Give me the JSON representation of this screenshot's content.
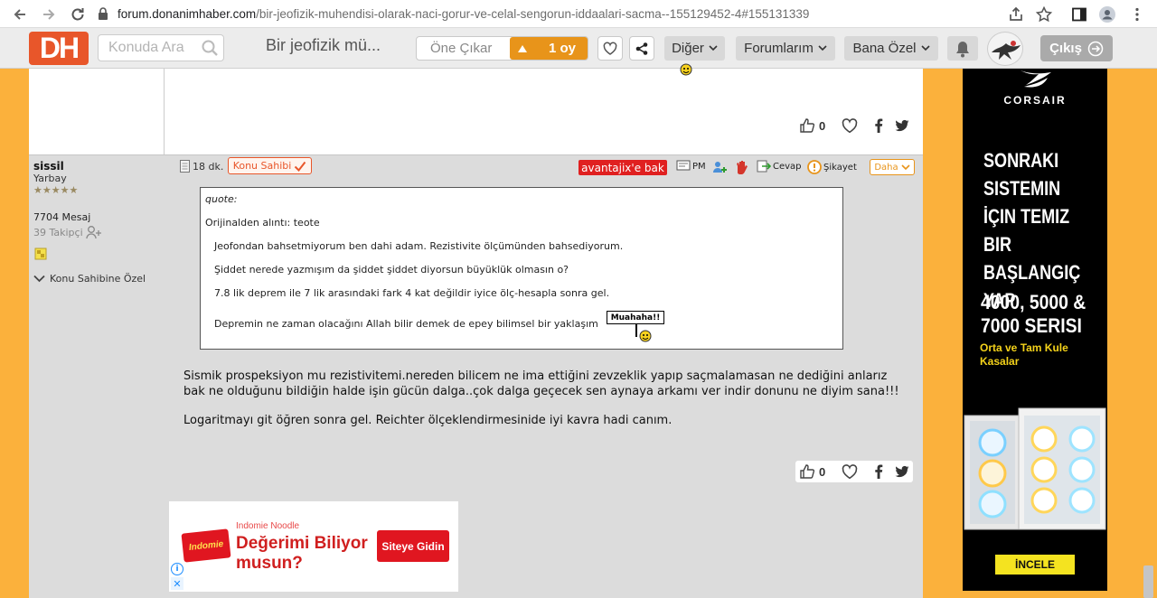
{
  "browser": {
    "url_host": "forum.donanimhaber.com",
    "url_path": "/bir-jeofizik-muhendisi-olarak-naci-gorur-ve-celal-sengorun-iddaalari-sacma--155129452-4#155131339"
  },
  "header": {
    "logo": "DH",
    "search_placeholder": "Konuda Ara",
    "topic_title": "Bir jeofizik mü...",
    "featured_label": "Öne Çıkar",
    "vote_label": "1 oy",
    "menu_other": "Diğer",
    "menu_forums": "Forumlarım",
    "menu_personal": "Bana Özel",
    "logout": "Çıkış"
  },
  "previous_post": {
    "like_count": "0"
  },
  "user": {
    "name": "sissil",
    "rank": "Yarbay",
    "stars": "★★★★★",
    "messages": "7704 Mesaj",
    "followers": "39 Takipçi",
    "owner_private": "Konu Sahibine Özel"
  },
  "post": {
    "time": "18 dk.",
    "owner_tag": "Konu Sahibi",
    "ad_link": "avantajix'e bak",
    "pm": "PM",
    "reply": "Cevap",
    "report": "Şikayet",
    "more": "Daha",
    "quote": {
      "header": "quote:",
      "from": "Orijinalden alıntı: teote",
      "lines": [
        "Jeofondan bahsetmiyorum ben dahi adam. Rezistivite ölçümünden bahsediyorum.",
        "Şiddet  nerede yazmışım da şiddet şiddet diyorsun büyüklük olmasın o?",
        "7.8 lik deprem ile 7 lik arasındaki fark 4 kat değildir iyice ölç-hesapla sonra gel.",
        "Depremin ne zaman olacağını Allah bilir demek de epey bilimsel bir yaklaşım"
      ],
      "emote_text": "Muahaha!!"
    },
    "body": [
      "Sismik prospeksiyon mu rezistivitemi.nereden bilicem ne ima ettiğini zevzeklik yapıp saçmalamasan ne dediğini anlarız",
      "bak ne olduğunu bildiğin halde işin gücün dalga..çok dalga geçecek sen aynaya arkamı ver indir donunu ne diyim sana!!!",
      "Logaritmayı git öğren sonra gel. Reichter ölçeklendirmesinide iyi kavra hadi canım."
    ],
    "like_count": "0"
  },
  "bottom_ad": {
    "brand": "Indomie Noodle",
    "headline": "Değerimi Biliyor musun?",
    "cta": "Siteye Gidin"
  },
  "side_ad": {
    "brand": "CORSAIR",
    "headline": "SONRAKI SISTEMIN İÇIN TEMIZ BIR BAŞLANGIÇ YAP",
    "series": "4000, 5000 & 7000 SERISI",
    "subtitle": "Orta ve Tam Kule Kasalar",
    "cta": "İNCELE"
  },
  "colors": {
    "brand": "#e8562a",
    "accent": "#e8941a",
    "page_bg": "#fbb13c",
    "post_bg": "#dcdcdc"
  }
}
